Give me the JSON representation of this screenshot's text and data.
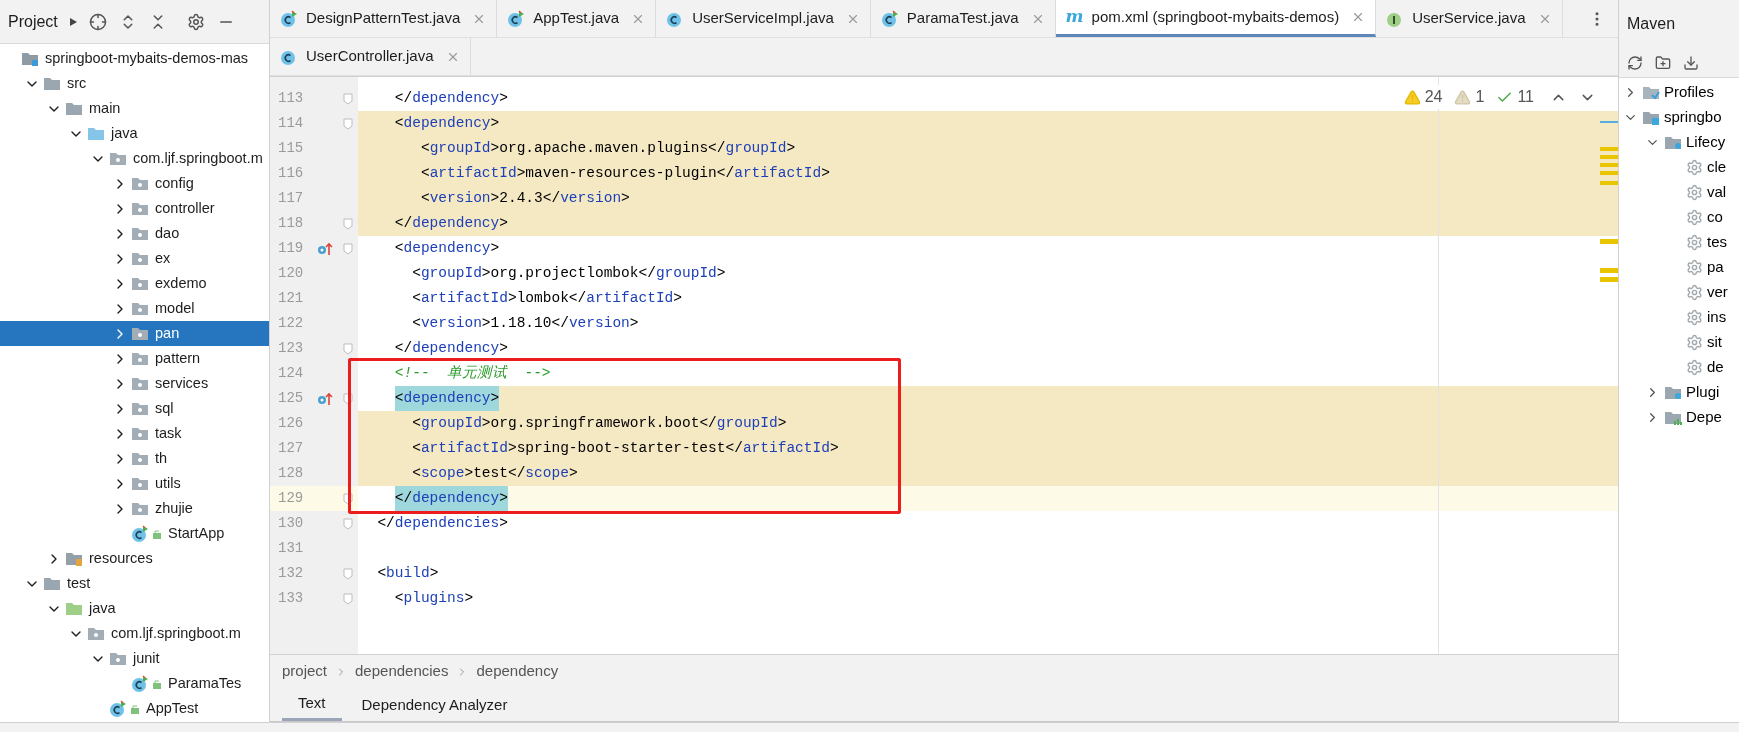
{
  "project_panel": {
    "title": "Project",
    "tree": [
      {
        "label": "springboot-mybaits-demos-mas",
        "kind": "module",
        "selected": false,
        "children": [
          {
            "label": "src",
            "kind": "folder",
            "expanded": true,
            "selected": false,
            "children": [
              {
                "label": "main",
                "kind": "folder",
                "expanded": true,
                "selected": false,
                "children": [
                  {
                    "label": "java",
                    "kind": "source",
                    "expanded": true,
                    "selected": false,
                    "children": [
                      {
                        "label": "com.ljf.springboot.m",
                        "kind": "package",
                        "expanded": true,
                        "selected": false,
                        "children": [
                          {
                            "label": "config",
                            "kind": "package",
                            "expanded": false,
                            "selected": false
                          },
                          {
                            "label": "controller",
                            "kind": "package",
                            "expanded": false,
                            "selected": false
                          },
                          {
                            "label": "dao",
                            "kind": "package",
                            "expanded": false,
                            "selected": false
                          },
                          {
                            "label": "ex",
                            "kind": "package",
                            "expanded": false,
                            "selected": false
                          },
                          {
                            "label": "exdemo",
                            "kind": "package",
                            "expanded": false,
                            "selected": false
                          },
                          {
                            "label": "model",
                            "kind": "package",
                            "expanded": false,
                            "selected": false
                          },
                          {
                            "label": "pan",
                            "kind": "package",
                            "expanded": false,
                            "selected": true
                          },
                          {
                            "label": "pattern",
                            "kind": "package",
                            "expanded": false,
                            "selected": false
                          },
                          {
                            "label": "services",
                            "kind": "package",
                            "expanded": false,
                            "selected": false
                          },
                          {
                            "label": "sql",
                            "kind": "package",
                            "expanded": false,
                            "selected": false
                          },
                          {
                            "label": "task",
                            "kind": "package",
                            "expanded": false,
                            "selected": false
                          },
                          {
                            "label": "th",
                            "kind": "package",
                            "expanded": false,
                            "selected": false
                          },
                          {
                            "label": "utils",
                            "kind": "package",
                            "expanded": false,
                            "selected": false
                          },
                          {
                            "label": "zhujie",
                            "kind": "package",
                            "expanded": false,
                            "selected": false
                          },
                          {
                            "label": "StartApp",
                            "kind": "class",
                            "selected": false
                          }
                        ]
                      }
                    ]
                  }
                ]
              },
              {
                "label": "resources",
                "kind": "resources",
                "expanded": false,
                "selected": false
              }
            ]
          },
          {
            "label": "test",
            "kind": "folder",
            "expanded": true,
            "selected": false,
            "children": [
              {
                "label": "java",
                "kind": "test-source",
                "expanded": true,
                "selected": false,
                "children": [
                  {
                    "label": "com.ljf.springboot.m",
                    "kind": "package",
                    "expanded": true,
                    "selected": false,
                    "children": [
                      {
                        "label": "junit",
                        "kind": "package",
                        "expanded": true,
                        "selected": false,
                        "children": [
                          {
                            "label": "ParamaTes",
                            "kind": "class",
                            "selected": false
                          }
                        ]
                      },
                      {
                        "label": "AppTest",
                        "kind": "class",
                        "selected": false
                      }
                    ]
                  }
                ]
              }
            ]
          }
        ]
      }
    ]
  },
  "tabs": [
    [
      {
        "label": "DesignPatternTest.java",
        "kind": "test",
        "selected": false
      },
      {
        "label": "AppTest.java",
        "kind": "test",
        "selected": false
      },
      {
        "label": "UserServiceImpl.java",
        "kind": "class",
        "selected": false
      },
      {
        "label": "ParamaTest.java",
        "kind": "test",
        "selected": false
      },
      {
        "label": "pom.xml (springboot-mybaits-demos)",
        "kind": "maven",
        "icon": "m",
        "selected": true
      },
      {
        "label": "UserService.java",
        "kind": "interface",
        "selected": false
      }
    ],
    [
      {
        "label": "UserController.java",
        "kind": "class",
        "selected": false
      }
    ]
  ],
  "inspections": [
    {
      "kind": "warning",
      "count": "24"
    },
    {
      "kind": "weak-warning",
      "count": "1"
    },
    {
      "kind": "typo",
      "count": "11"
    }
  ],
  "editor": {
    "lines": [
      {
        "number": "113",
        "text": "    </dependency>",
        "changed": false,
        "fold": true
      },
      {
        "number": "114",
        "text": "    <dependency>",
        "changed": true,
        "fold": true
      },
      {
        "number": "115",
        "text": "       <groupId>org.apache.maven.plugins</groupId>",
        "changed": true
      },
      {
        "number": "116",
        "text": "       <artifactId>maven-resources-plugin</artifactId>",
        "changed": true
      },
      {
        "number": "117",
        "text": "       <version>2.4.3</version>",
        "changed": true
      },
      {
        "number": "118",
        "text": "    </dependency>",
        "changed": true,
        "fold": true
      },
      {
        "number": "119",
        "text": "    <dependency>",
        "marker": true,
        "fold": true
      },
      {
        "number": "120",
        "text": "      <groupId>org.projectlombok</groupId>"
      },
      {
        "number": "121",
        "text": "      <artifactId>lombok</artifactId>"
      },
      {
        "number": "122",
        "text": "      <version>1.18.10</version>"
      },
      {
        "number": "123",
        "text": "    </dependency>",
        "fold": true
      },
      {
        "number": "124",
        "text": "    <!--  单元测试  -->",
        "kind": "comment",
        "boxed": true
      },
      {
        "number": "125",
        "text": "    <dependency>",
        "changed": true,
        "brace_match": true,
        "marker": true,
        "fold": true,
        "boxed": true
      },
      {
        "number": "126",
        "text": "      <groupId>org.springframework.boot</groupId>",
        "changed": true,
        "boxed": true
      },
      {
        "number": "127",
        "text": "      <artifactId>spring-boot-starter-test</artifactId>",
        "changed": true,
        "boxed": true
      },
      {
        "number": "128",
        "text": "      <scope>test</scope>",
        "changed": true,
        "boxed": true
      },
      {
        "number": "129",
        "text": "    </dependency>",
        "current": true,
        "brace_match": true,
        "fold": true,
        "boxed": true
      },
      {
        "number": "130",
        "text": "  </dependencies>",
        "fold": true
      },
      {
        "number": "131"
      },
      {
        "number": "132",
        "text": "  <build>",
        "fold": true
      },
      {
        "number": "133",
        "text": "    <plugins>",
        "fold": true
      }
    ]
  },
  "breadcrumbs": [
    "project",
    "dependencies",
    "dependency"
  ],
  "bottom_tabs": [
    {
      "label": "Text",
      "selected": true
    },
    {
      "label": "Dependency Analyzer",
      "selected": false
    }
  ],
  "maven_panel": {
    "title": "Maven",
    "tree": [
      {
        "label": "Profiles",
        "kind": "profiles",
        "expanded": false
      },
      {
        "label": "springbo",
        "kind": "project",
        "expanded": true,
        "children": [
          {
            "label": "Lifecy",
            "kind": "group",
            "expanded": true,
            "children": [
              {
                "label": "cle",
                "kind": "goal"
              },
              {
                "label": "val",
                "kind": "goal"
              },
              {
                "label": "co",
                "kind": "goal"
              },
              {
                "label": "tes",
                "kind": "goal"
              },
              {
                "label": "pa",
                "kind": "goal"
              },
              {
                "label": "ver",
                "kind": "goal"
              },
              {
                "label": "ins",
                "kind": "goal"
              },
              {
                "label": "sit",
                "kind": "goal"
              },
              {
                "label": "de",
                "kind": "goal"
              }
            ]
          },
          {
            "label": "Plugi",
            "kind": "group",
            "expanded": false
          },
          {
            "label": "Depe",
            "kind": "deps",
            "expanded": false
          }
        ]
      }
    ]
  }
}
